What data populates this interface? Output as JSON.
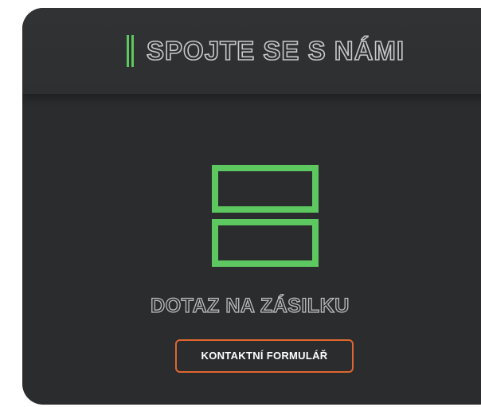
{
  "header": {
    "title": "SPOJTE SE S NÁMI"
  },
  "main": {
    "icon": "package-icon",
    "section_title": "DOTAZ NA ZÁSILKU",
    "contact_button_label": "KONTAKTNÍ FORMULÁŘ"
  },
  "colors": {
    "card_background": "#2a2c2e",
    "accent_green": "#5cc85f",
    "button_border": "#e0662f",
    "text_outline": "#c9c9c9"
  }
}
